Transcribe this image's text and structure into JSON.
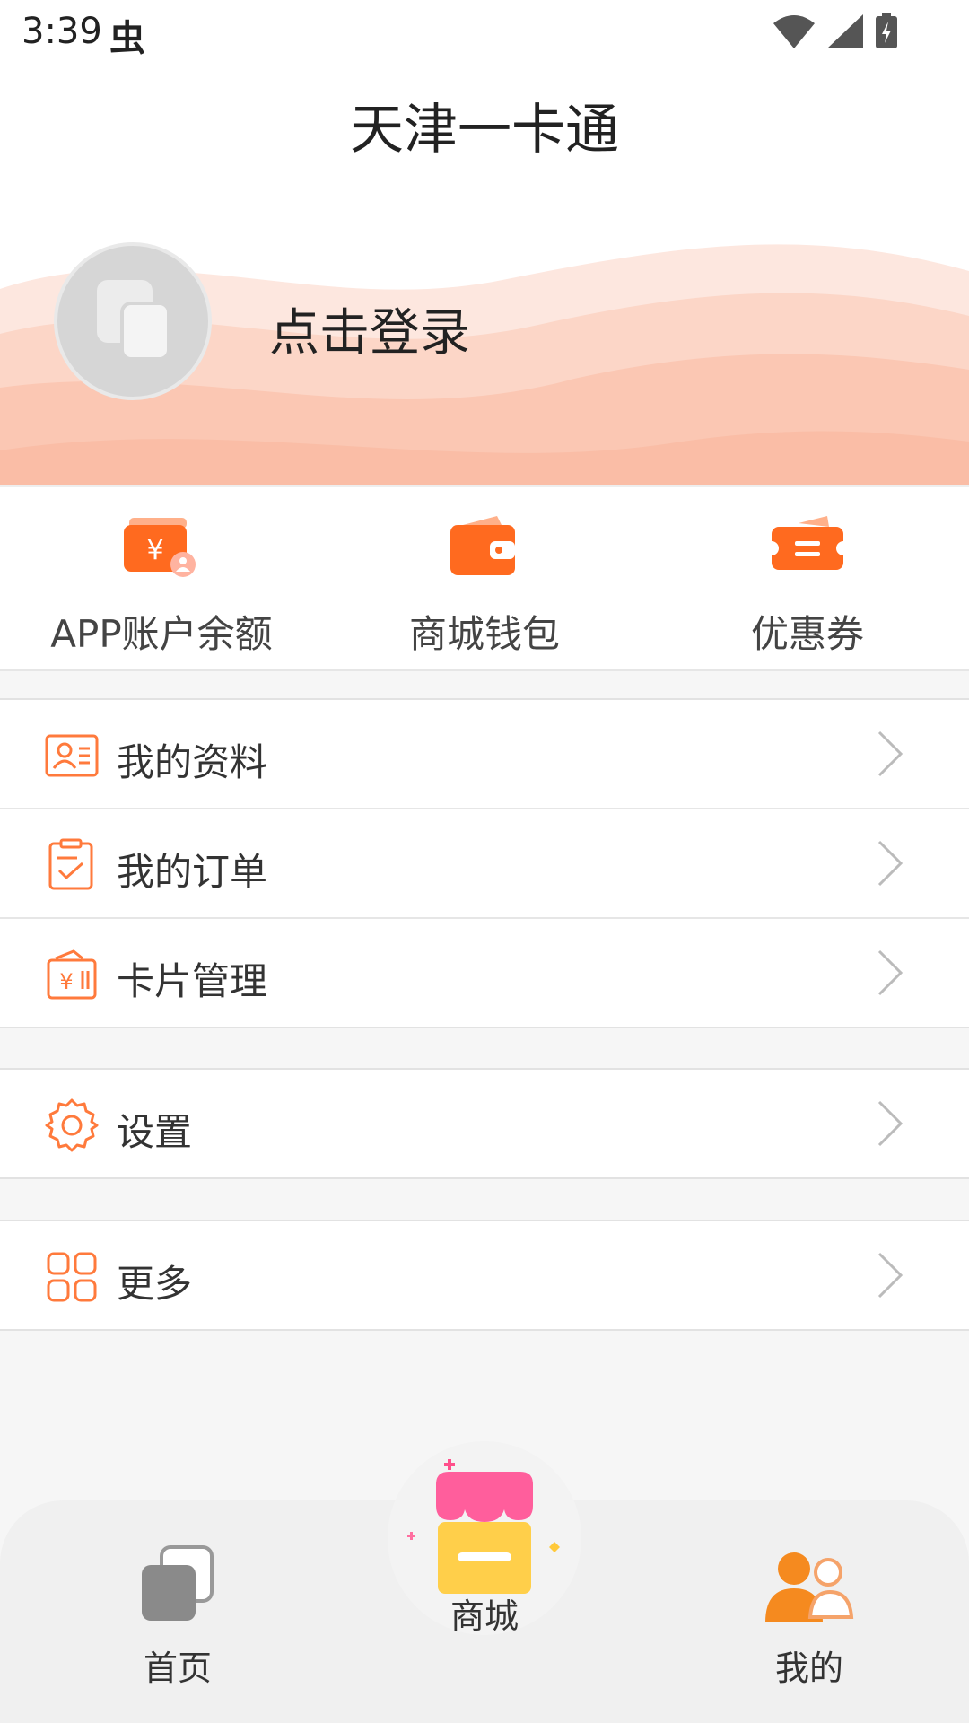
{
  "status_bar": {
    "time": "3:39",
    "bug_glyph": "虫"
  },
  "header": {
    "title": "天津一卡通"
  },
  "profile": {
    "login_text": "点击登录"
  },
  "quick_actions": [
    {
      "label": "APP账户余额",
      "icon": "balance-icon"
    },
    {
      "label": "商城钱包",
      "icon": "wallet-icon"
    },
    {
      "label": "优惠券",
      "icon": "coupon-icon"
    }
  ],
  "menu": {
    "group1": [
      {
        "label": "我的资料",
        "icon": "profile-card-icon"
      },
      {
        "label": "我的订单",
        "icon": "order-icon"
      },
      {
        "label": "卡片管理",
        "icon": "card-manage-icon"
      }
    ],
    "settings": {
      "label": "设置",
      "icon": "gear-icon"
    },
    "more": {
      "label": "更多",
      "icon": "grid-icon"
    }
  },
  "bottom_nav": {
    "home": "首页",
    "mall": "商城",
    "mine": "我的"
  },
  "colors": {
    "accent": "#ff6a1f",
    "active_nav": "#f58a1f"
  }
}
